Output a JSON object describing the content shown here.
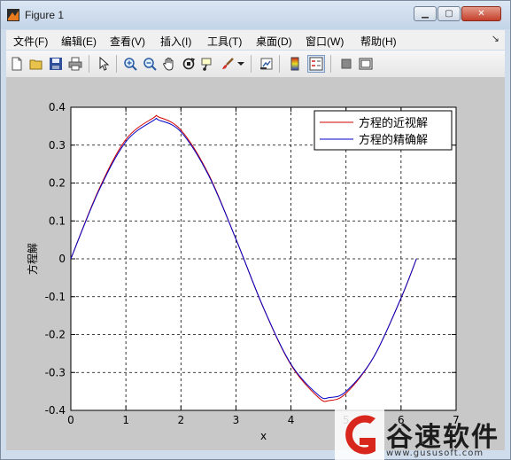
{
  "window": {
    "title": "Figure 1"
  },
  "menu": [
    {
      "label": "文件(F)"
    },
    {
      "label": "编辑(E)"
    },
    {
      "label": "查看(V)"
    },
    {
      "label": "插入(I)"
    },
    {
      "label": "工具(T)"
    },
    {
      "label": "桌面(D)"
    },
    {
      "label": "窗口(W)"
    },
    {
      "label": "帮助(H)"
    }
  ],
  "toolbar": {
    "icons": [
      "new-figure-icon",
      "open-file-icon",
      "save-icon",
      "print-icon",
      "edit-plot-arrow-icon",
      "zoom-in-icon",
      "zoom-out-icon",
      "pan-hand-icon",
      "rotate-3d-icon",
      "data-cursor-icon",
      "brush-icon",
      "brush-dropdown-icon",
      "link-plot-icon",
      "colorbar-icon",
      "legend-icon",
      "hide-plot-tools-icon",
      "show-plot-tools-icon"
    ]
  },
  "chart_data": {
    "type": "line",
    "xlabel": "x",
    "ylabel": "方程解",
    "xlim": [
      0,
      7
    ],
    "ylim": [
      -0.4,
      0.4
    ],
    "xticks": [
      "0",
      "1",
      "2",
      "3",
      "4",
      "5",
      "6",
      "7"
    ],
    "yticks": [
      "0.4",
      "0.3",
      "0.2",
      "0.1",
      "0",
      "-0.1",
      "-0.2",
      "-0.3",
      "-0.4"
    ],
    "grid": true,
    "legend_position": "top-right",
    "series": [
      {
        "name": "方程的近视解",
        "color": "#d00000",
        "x": [
          0,
          0.5,
          1,
          1.5,
          1.6,
          2,
          2.5,
          3,
          3.5,
          4,
          4.5,
          4.7,
          5,
          5.5,
          6,
          6.28
        ],
        "y": [
          0,
          0.18,
          0.315,
          0.372,
          0.374,
          0.34,
          0.224,
          0.052,
          -0.13,
          -0.28,
          -0.366,
          -0.374,
          -0.355,
          -0.26,
          -0.104,
          0
        ]
      },
      {
        "name": "方程的精确解",
        "color": "#0000c8",
        "x": [
          0,
          0.5,
          1,
          1.5,
          1.6,
          2,
          2.5,
          3,
          3.5,
          4,
          4.5,
          4.7,
          5,
          5.5,
          6,
          6.28
        ],
        "y": [
          0,
          0.177,
          0.309,
          0.365,
          0.366,
          0.335,
          0.221,
          0.052,
          -0.129,
          -0.278,
          -0.36,
          -0.366,
          -0.35,
          -0.26,
          -0.103,
          0
        ]
      }
    ]
  },
  "watermark": {
    "brand": "谷速软件",
    "url": "www.gususoft.com",
    "colors": [
      "#d9261c"
    ]
  }
}
